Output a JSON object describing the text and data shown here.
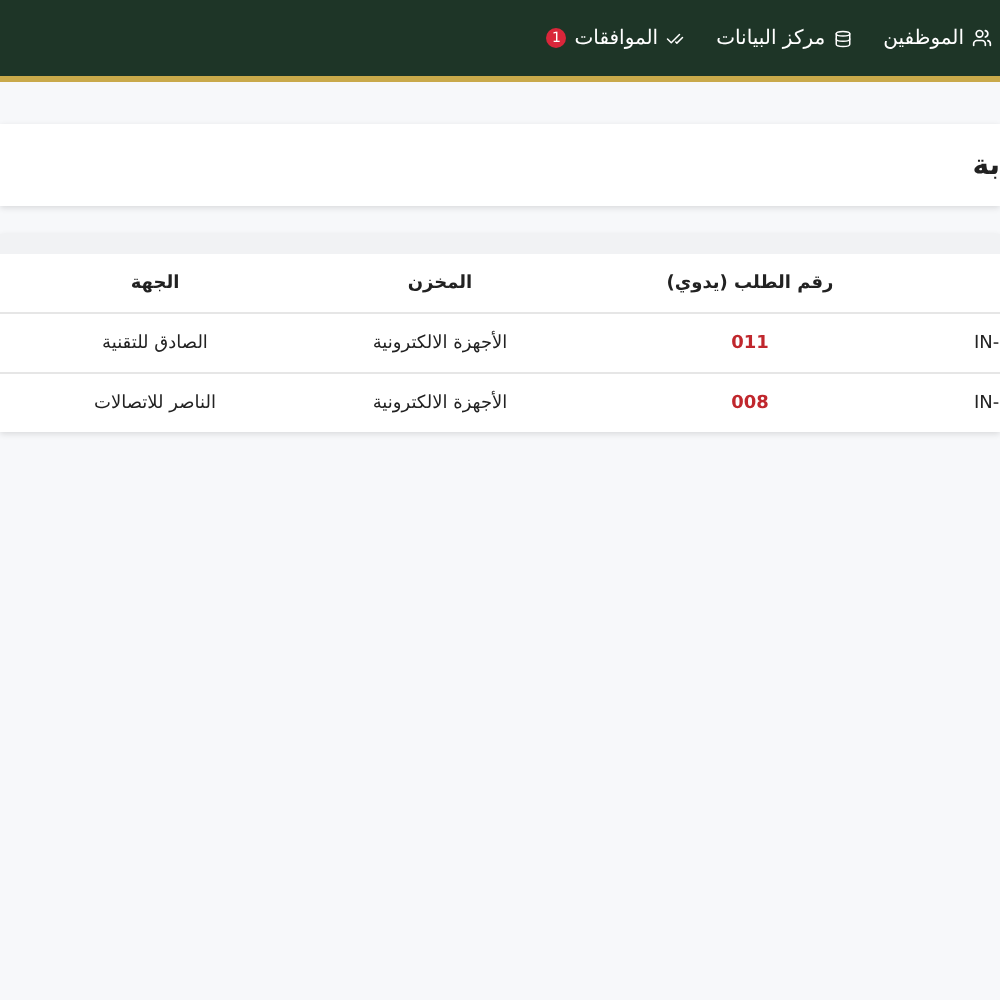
{
  "navbar": {
    "items": [
      {
        "kind": "employees",
        "label": "الموظفين"
      },
      {
        "kind": "database",
        "label": "مركز البيانات"
      },
      {
        "kind": "approvals",
        "label": "الموافقات",
        "badge": "1"
      }
    ]
  },
  "card": {
    "title": "بة"
  },
  "table": {
    "columns": [
      "رقم الطلب (يدوي)",
      "المخزن",
      "الجهة"
    ],
    "rows": [
      {
        "code": "IN-",
        "number": "011",
        "store": "الأجهزة الالكترونية",
        "party": "الصادق للتقنية"
      },
      {
        "code": "IN-",
        "number": "008",
        "store": "الأجهزة الالكترونية",
        "party": "الناصر للاتصالات"
      }
    ]
  }
}
